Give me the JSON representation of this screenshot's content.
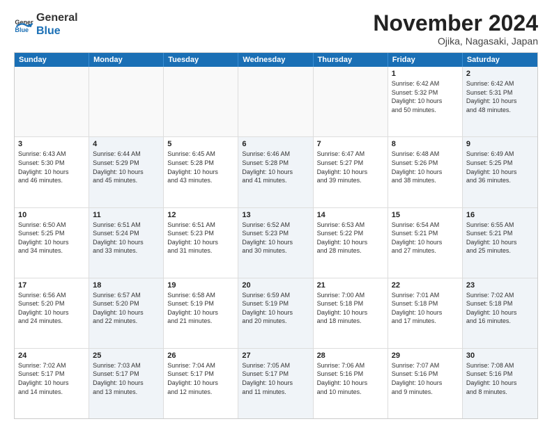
{
  "header": {
    "logo_general": "General",
    "logo_blue": "Blue",
    "month_title": "November 2024",
    "location": "Ojika, Nagasaki, Japan"
  },
  "weekdays": [
    "Sunday",
    "Monday",
    "Tuesday",
    "Wednesday",
    "Thursday",
    "Friday",
    "Saturday"
  ],
  "rows": [
    [
      {
        "day": "",
        "text": "",
        "empty": true
      },
      {
        "day": "",
        "text": "",
        "empty": true
      },
      {
        "day": "",
        "text": "",
        "empty": true
      },
      {
        "day": "",
        "text": "",
        "empty": true
      },
      {
        "day": "",
        "text": "",
        "empty": true
      },
      {
        "day": "1",
        "text": "Sunrise: 6:42 AM\nSunset: 5:32 PM\nDaylight: 10 hours\nand 50 minutes.",
        "shade": false
      },
      {
        "day": "2",
        "text": "Sunrise: 6:42 AM\nSunset: 5:31 PM\nDaylight: 10 hours\nand 48 minutes.",
        "shade": true
      }
    ],
    [
      {
        "day": "3",
        "text": "Sunrise: 6:43 AM\nSunset: 5:30 PM\nDaylight: 10 hours\nand 46 minutes.",
        "shade": false
      },
      {
        "day": "4",
        "text": "Sunrise: 6:44 AM\nSunset: 5:29 PM\nDaylight: 10 hours\nand 45 minutes.",
        "shade": true
      },
      {
        "day": "5",
        "text": "Sunrise: 6:45 AM\nSunset: 5:28 PM\nDaylight: 10 hours\nand 43 minutes.",
        "shade": false
      },
      {
        "day": "6",
        "text": "Sunrise: 6:46 AM\nSunset: 5:28 PM\nDaylight: 10 hours\nand 41 minutes.",
        "shade": true
      },
      {
        "day": "7",
        "text": "Sunrise: 6:47 AM\nSunset: 5:27 PM\nDaylight: 10 hours\nand 39 minutes.",
        "shade": false
      },
      {
        "day": "8",
        "text": "Sunrise: 6:48 AM\nSunset: 5:26 PM\nDaylight: 10 hours\nand 38 minutes.",
        "shade": false
      },
      {
        "day": "9",
        "text": "Sunrise: 6:49 AM\nSunset: 5:25 PM\nDaylight: 10 hours\nand 36 minutes.",
        "shade": true
      }
    ],
    [
      {
        "day": "10",
        "text": "Sunrise: 6:50 AM\nSunset: 5:25 PM\nDaylight: 10 hours\nand 34 minutes.",
        "shade": false
      },
      {
        "day": "11",
        "text": "Sunrise: 6:51 AM\nSunset: 5:24 PM\nDaylight: 10 hours\nand 33 minutes.",
        "shade": true
      },
      {
        "day": "12",
        "text": "Sunrise: 6:51 AM\nSunset: 5:23 PM\nDaylight: 10 hours\nand 31 minutes.",
        "shade": false
      },
      {
        "day": "13",
        "text": "Sunrise: 6:52 AM\nSunset: 5:23 PM\nDaylight: 10 hours\nand 30 minutes.",
        "shade": true
      },
      {
        "day": "14",
        "text": "Sunrise: 6:53 AM\nSunset: 5:22 PM\nDaylight: 10 hours\nand 28 minutes.",
        "shade": false
      },
      {
        "day": "15",
        "text": "Sunrise: 6:54 AM\nSunset: 5:21 PM\nDaylight: 10 hours\nand 27 minutes.",
        "shade": false
      },
      {
        "day": "16",
        "text": "Sunrise: 6:55 AM\nSunset: 5:21 PM\nDaylight: 10 hours\nand 25 minutes.",
        "shade": true
      }
    ],
    [
      {
        "day": "17",
        "text": "Sunrise: 6:56 AM\nSunset: 5:20 PM\nDaylight: 10 hours\nand 24 minutes.",
        "shade": false
      },
      {
        "day": "18",
        "text": "Sunrise: 6:57 AM\nSunset: 5:20 PM\nDaylight: 10 hours\nand 22 minutes.",
        "shade": true
      },
      {
        "day": "19",
        "text": "Sunrise: 6:58 AM\nSunset: 5:19 PM\nDaylight: 10 hours\nand 21 minutes.",
        "shade": false
      },
      {
        "day": "20",
        "text": "Sunrise: 6:59 AM\nSunset: 5:19 PM\nDaylight: 10 hours\nand 20 minutes.",
        "shade": true
      },
      {
        "day": "21",
        "text": "Sunrise: 7:00 AM\nSunset: 5:18 PM\nDaylight: 10 hours\nand 18 minutes.",
        "shade": false
      },
      {
        "day": "22",
        "text": "Sunrise: 7:01 AM\nSunset: 5:18 PM\nDaylight: 10 hours\nand 17 minutes.",
        "shade": false
      },
      {
        "day": "23",
        "text": "Sunrise: 7:02 AM\nSunset: 5:18 PM\nDaylight: 10 hours\nand 16 minutes.",
        "shade": true
      }
    ],
    [
      {
        "day": "24",
        "text": "Sunrise: 7:02 AM\nSunset: 5:17 PM\nDaylight: 10 hours\nand 14 minutes.",
        "shade": false
      },
      {
        "day": "25",
        "text": "Sunrise: 7:03 AM\nSunset: 5:17 PM\nDaylight: 10 hours\nand 13 minutes.",
        "shade": true
      },
      {
        "day": "26",
        "text": "Sunrise: 7:04 AM\nSunset: 5:17 PM\nDaylight: 10 hours\nand 12 minutes.",
        "shade": false
      },
      {
        "day": "27",
        "text": "Sunrise: 7:05 AM\nSunset: 5:17 PM\nDaylight: 10 hours\nand 11 minutes.",
        "shade": true
      },
      {
        "day": "28",
        "text": "Sunrise: 7:06 AM\nSunset: 5:16 PM\nDaylight: 10 hours\nand 10 minutes.",
        "shade": false
      },
      {
        "day": "29",
        "text": "Sunrise: 7:07 AM\nSunset: 5:16 PM\nDaylight: 10 hours\nand 9 minutes.",
        "shade": false
      },
      {
        "day": "30",
        "text": "Sunrise: 7:08 AM\nSunset: 5:16 PM\nDaylight: 10 hours\nand 8 minutes.",
        "shade": true
      }
    ]
  ]
}
